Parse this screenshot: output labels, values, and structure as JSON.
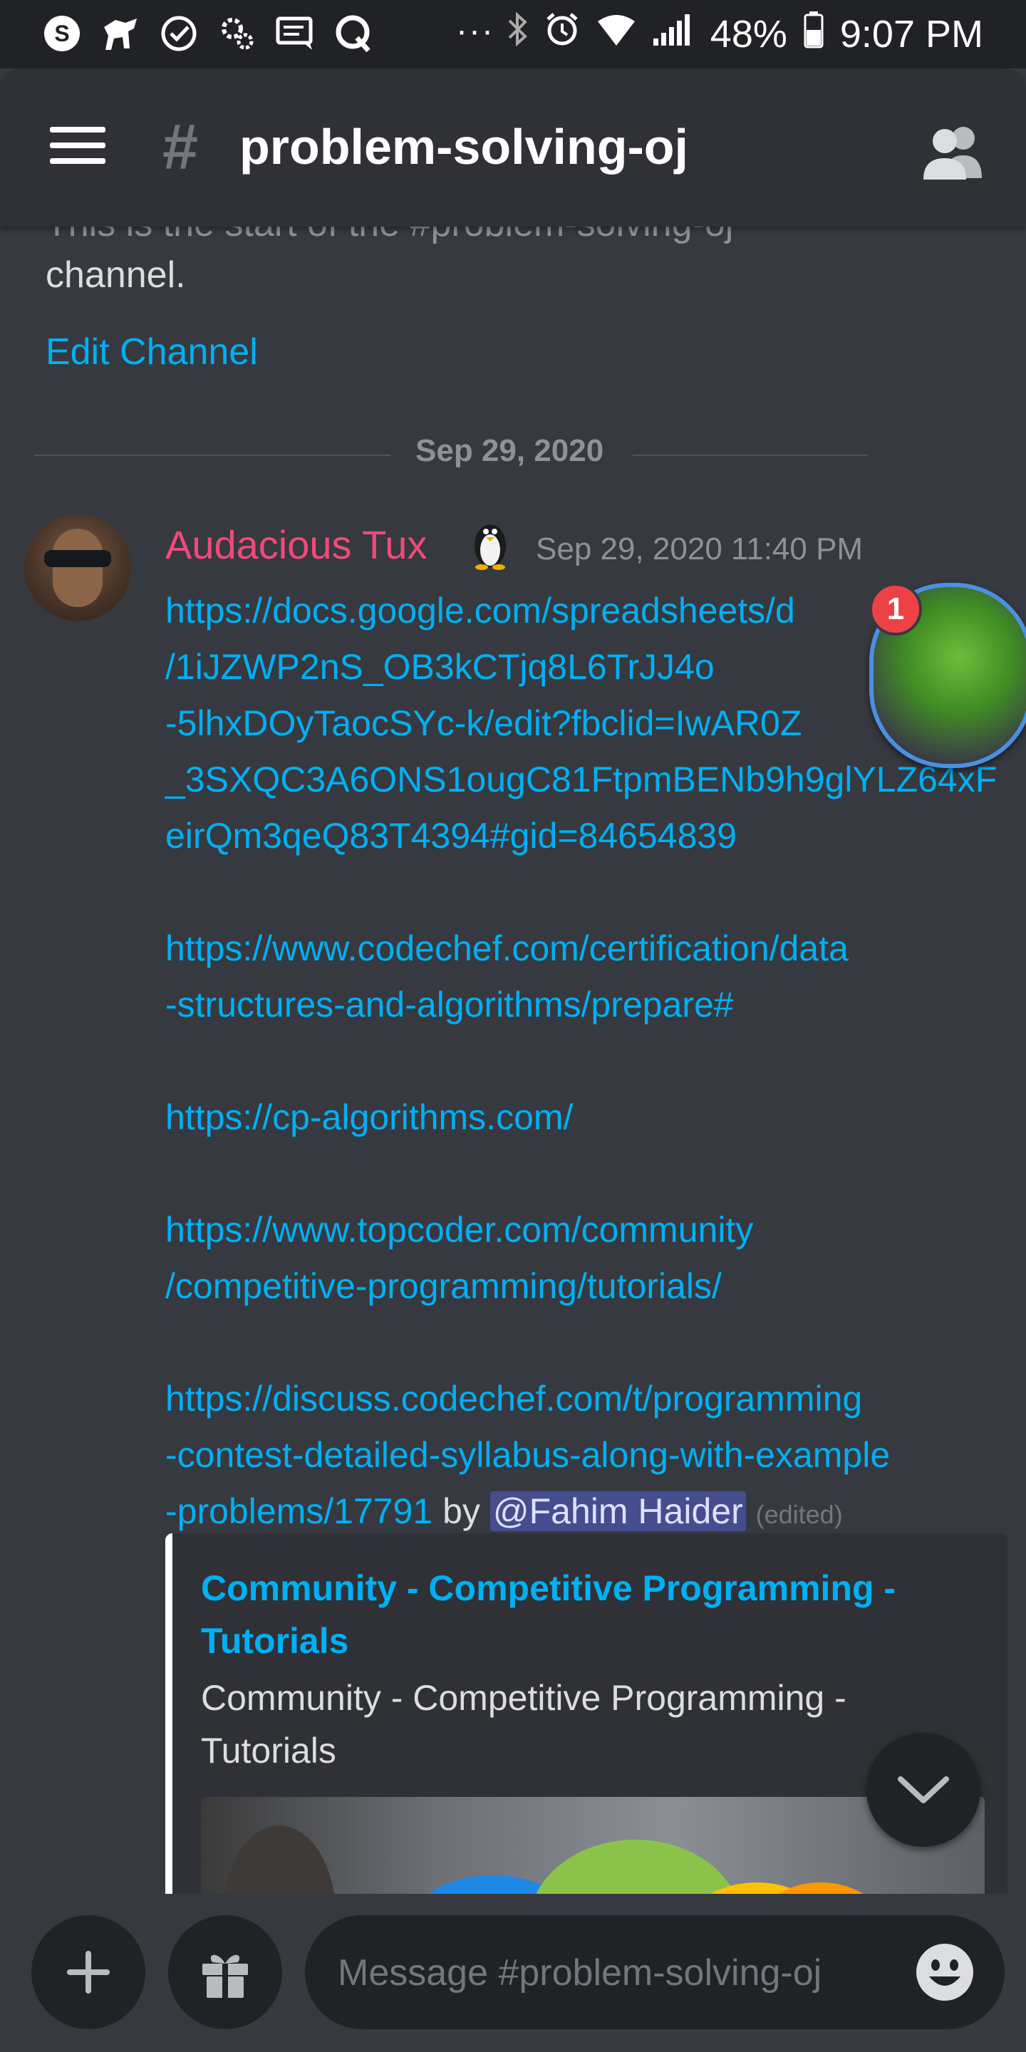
{
  "status_bar": {
    "time": "9:07 PM",
    "battery": "48%",
    "overflow": "···",
    "app_icons": [
      "skype-icon",
      "horse-icon",
      "check-circle-icon",
      "settings-icon",
      "message-icon",
      "quora-icon"
    ]
  },
  "header": {
    "hash": "#",
    "channel_name": "problem-solving-oj"
  },
  "chat": {
    "intro_faded": "This is the start of the #problem-solving-oj",
    "intro_rest": "channel.",
    "edit_channel": "Edit Channel",
    "date_divider": "Sep 29, 2020",
    "message": {
      "author": "Audacious Tux",
      "author_color": "#f04a7a",
      "timestamp": "Sep 29, 2020 11:40 PM",
      "links": [
        [
          "https://docs.google.com/spreadsheets/d",
          "/1iJZWP2nS_OB3kCTjq8L6TrJJ4o",
          "-5lhxDOyTaocSYc-k/edit?fbclid=IwAR0Z",
          "_3SXQC3A6ONS1ougC81FtpmBENb9h9glYLZ64xF",
          "eirQm3qeQ83T4394#gid=84654839"
        ],
        [
          "https://www.codechef.com/certification/data",
          "-structures-and-algorithms/prepare#"
        ],
        [
          "https://cp-algorithms.com/"
        ],
        [
          "https://www.topcoder.com/community",
          "/competitive-programming/tutorials/"
        ],
        [
          "https://discuss.codechef.com/t/programming",
          "-contest-detailed-syllabus-along-with-example"
        ]
      ],
      "last_link_tail": "-problems/17791",
      "by_text": "by",
      "mention": "@Fahim Haider",
      "edited": "(edited)"
    },
    "embed": {
      "title": "Community - Competitive Programming - Tutorials",
      "description": "Community - Competitive Programming - Tutorials"
    }
  },
  "floating_chat_head": {
    "badge_count": "1"
  },
  "composer": {
    "placeholder": "Message #problem-solving-oj"
  },
  "colors": {
    "link": "#00b0f4",
    "background": "#36393f",
    "header": "#2f3136",
    "badge": "#ed4245"
  }
}
